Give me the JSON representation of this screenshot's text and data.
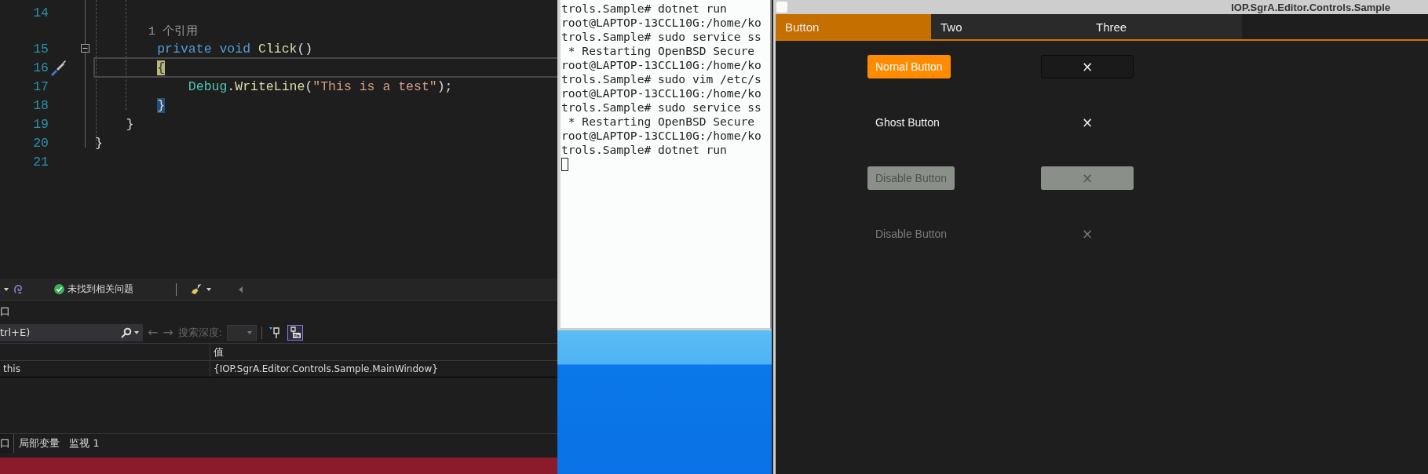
{
  "editor": {
    "lines": [
      {
        "kind": "code",
        "number": "14",
        "current": false,
        "fold_toggle": false
      },
      {
        "kind": "codelens",
        "text": "        1 个引用"
      },
      {
        "kind": "code",
        "number": "15",
        "current": false,
        "fold_toggle": true,
        "tokens": [
          {
            "kind": "keyword",
            "text": "        private void"
          },
          {
            "kind": "method",
            "text": " Click"
          },
          {
            "kind": "punct",
            "text": "()"
          }
        ]
      },
      {
        "kind": "code",
        "number": "16",
        "current": true,
        "fold_toggle": false,
        "tokens": [
          {
            "kind": "caret-brace",
            "text": "        {"
          }
        ]
      },
      {
        "kind": "code",
        "number": "17",
        "current": false,
        "fold_toggle": false,
        "tokens": [
          {
            "kind": "type",
            "text": "            Debug"
          },
          {
            "kind": "punct",
            "text": "."
          },
          {
            "kind": "method",
            "text": "WriteLine"
          },
          {
            "kind": "punct",
            "text": "("
          },
          {
            "kind": "string",
            "text": "\"This is a test\""
          },
          {
            "kind": "punct",
            "text": ");"
          }
        ]
      },
      {
        "kind": "code",
        "number": "18",
        "current": false,
        "fold_toggle": false,
        "tokens": [
          {
            "kind": "match-brace",
            "text": "        }"
          }
        ]
      },
      {
        "kind": "code",
        "number": "19",
        "current": false,
        "fold_toggle": false,
        "tokens": [
          {
            "kind": "punct",
            "text": "    }"
          }
        ]
      },
      {
        "kind": "code",
        "number": "20",
        "current": false,
        "fold_toggle": false,
        "tokens": [
          {
            "kind": "punct",
            "text": "}"
          }
        ]
      },
      {
        "kind": "code",
        "number": "21",
        "current": false,
        "fold_toggle": false
      }
    ]
  },
  "error_bar": {
    "status": "未找到相关问题"
  },
  "locals_panel": {
    "title": "口",
    "search": {
      "placeholder": "trl+E)"
    },
    "back": "←",
    "forward": "→",
    "depth_label": "搜索深度:",
    "toggles": [
      {
        "kind": "pin",
        "selected": false
      },
      {
        "kind": "pin-text",
        "selected": true
      }
    ],
    "value_column": "值",
    "rows": [
      {
        "name": "this",
        "value": "{IOP.SgrA.Editor.Controls.Sample.MainWindow}"
      }
    ],
    "tabs": [
      {
        "label": "口",
        "selected": true
      },
      {
        "label": "局部变量",
        "selected": false
      },
      {
        "label": "监视 1",
        "selected": false
      }
    ]
  },
  "terminal": {
    "cursor": true,
    "lines": [
      "trols.Sample# dotnet run",
      "root@LAPTOP-13CCL10G:/home/ko",
      "trols.Sample# sudo service ss",
      " * Restarting OpenBSD Secure ",
      "root@LAPTOP-13CCL10G:/home/ko",
      "trols.Sample# sudo vim /etc/s",
      "root@LAPTOP-13CCL10G:/home/ko",
      "trols.Sample# sudo service ss",
      " * Restarting OpenBSD Secure ",
      "root@LAPTOP-13CCL10G:/home/ko",
      "trols.Sample# dotnet run"
    ]
  },
  "app": {
    "title": "IOP.SgrA.Editor.Controls.Sample",
    "tabs": [
      {
        "label": "Button",
        "selected": true
      },
      {
        "label": "Two",
        "selected": false
      },
      {
        "label": "Three",
        "selected": false
      }
    ],
    "rows": [
      {
        "button": {
          "kind": "solid",
          "label": "Nornal Button",
          "disabled": false
        },
        "icon_button": {
          "kind": "outlined",
          "glyph": "×",
          "disabled": false
        }
      },
      {
        "button": {
          "kind": "ghost",
          "label": "Ghost Button",
          "disabled": false
        },
        "icon_button": {
          "kind": "ghost",
          "glyph": "×",
          "disabled": false
        }
      },
      {
        "button": {
          "kind": "solid",
          "label": "Disable Button",
          "disabled": true
        },
        "icon_button": {
          "kind": "solid",
          "glyph": "×",
          "disabled": true
        }
      },
      {
        "button": {
          "kind": "ghost",
          "label": "Disable Button",
          "disabled": true
        },
        "icon_button": {
          "kind": "ghost",
          "glyph": "×",
          "disabled": true
        }
      }
    ]
  }
}
